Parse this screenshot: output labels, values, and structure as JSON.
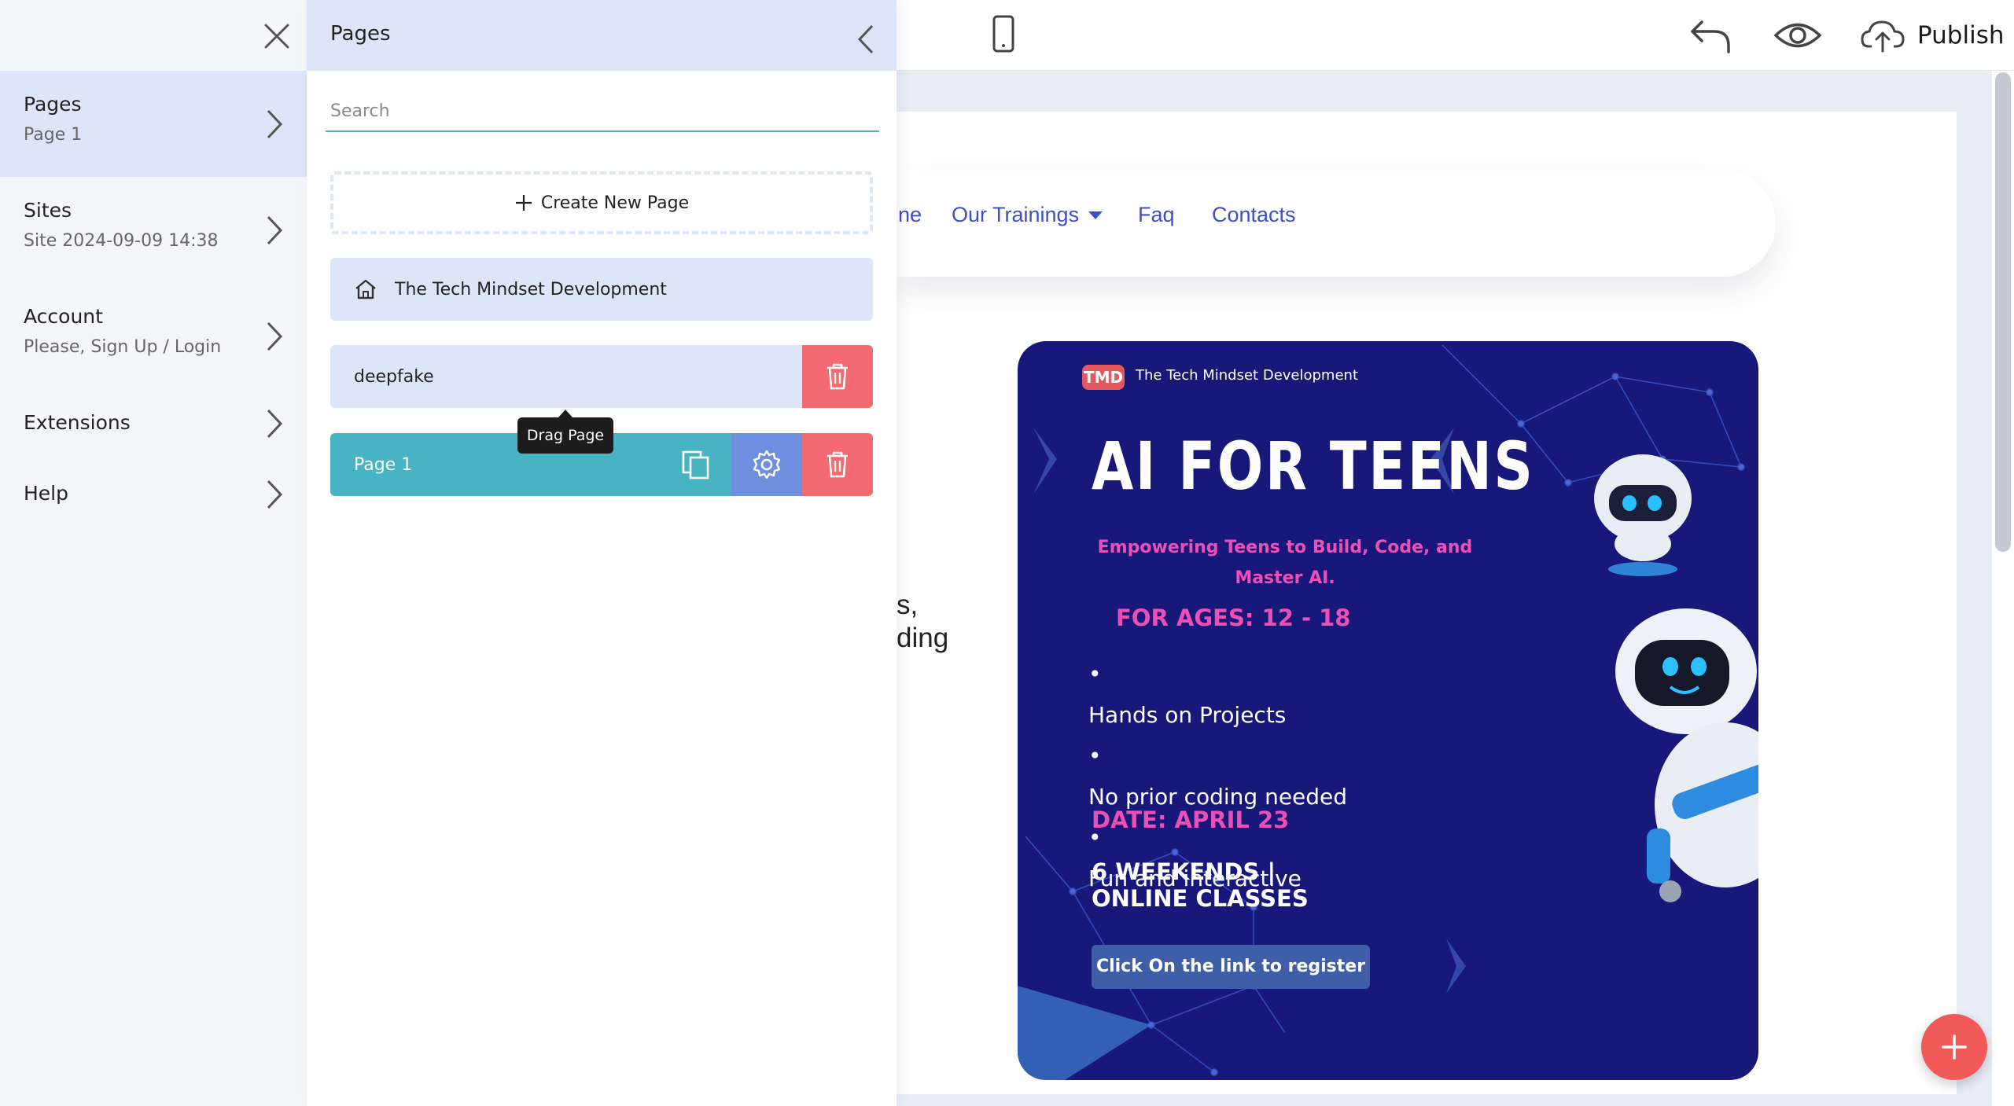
{
  "topbar": {
    "publish_label": "Publish",
    "icons": [
      "mobile-device-icon",
      "undo-icon",
      "preview-eye-icon",
      "cloud-upload-icon"
    ]
  },
  "left_menu": {
    "items": [
      {
        "title": "Pages",
        "subtitle": "Page 1"
      },
      {
        "title": "Sites",
        "subtitle": "Site 2024-09-09 14:38"
      },
      {
        "title": "Account",
        "subtitle": "Please, Sign Up / Login"
      },
      {
        "title": "Extensions"
      },
      {
        "title": "Help"
      }
    ]
  },
  "pages_panel": {
    "title": "Pages",
    "search_placeholder": "Search",
    "create_label": "Create New Page",
    "home_page": "The Tech Mindset Development",
    "pages": [
      "deepfake",
      "Page 1"
    ],
    "tooltip": "Drag Page"
  },
  "site_preview": {
    "nav": {
      "partial": "ne",
      "trainings": "Our Trainings",
      "faq": "Faq",
      "contacts": "Contacts"
    },
    "partial_text": [
      "s,",
      "ding"
    ],
    "flyer": {
      "logo": "TMD",
      "brand": "The Tech Mindset Development",
      "title": "AI FOR TEENS",
      "subtitle": "Empowering Teens to Build, Code, and Master AI.",
      "ages": "FOR AGES: 12 - 18",
      "bullets": [
        "Hands on Projects",
        "No prior coding needed",
        "Fun and interactive"
      ],
      "date": "DATE: APRIL 23",
      "weekends_line1": "6 WEEKENDS |",
      "weekends_line2": "ONLINE CLASSES",
      "cta": "Click On the link to register"
    }
  },
  "colors": {
    "accent_teal": "#48b3c2",
    "panel_blue": "#dde6f8",
    "delete_red": "#f46a70",
    "settings_blue": "#6e8ee0",
    "flyer_navy": "#17187a",
    "flyer_pink": "#ee4fb5",
    "fab_red": "#f25a5a",
    "nav_link": "#3b50c8"
  }
}
